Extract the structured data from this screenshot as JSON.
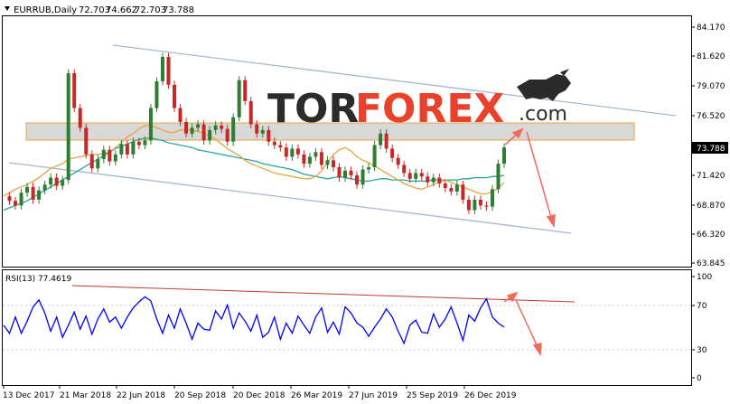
{
  "header": {
    "collapse_icon": "triangle-down-icon",
    "symbol": "EURRUB,Daily",
    "open": "72.703",
    "high": "74.662",
    "low": "72.703",
    "close": "73.788"
  },
  "logo": {
    "part1": "TOR",
    "part2": "FOREX",
    "part3": ".com",
    "icon": "bull-icon"
  },
  "price_axis": {
    "ticks": [
      "84.170",
      "81.620",
      "79.070",
      "76.520",
      "73.788",
      "71.420",
      "68.870",
      "66.320",
      "63.845"
    ],
    "current_price": "73.788",
    "range": [
      63.845,
      84.17
    ]
  },
  "rsi": {
    "label": "RSI(13) 77.4619",
    "levels": [
      "100",
      "70",
      "30",
      "0"
    ]
  },
  "date_axis": [
    "13 Dec 2017",
    "21 Mar 2018",
    "22 Jun 2018",
    "20 Sep 2018",
    "20 Dec 2018",
    "26 Mar 2019",
    "27 Jun 2019",
    "25 Sep 2019",
    "26 Dec 2019"
  ],
  "colors": {
    "bull_candle": "#2e7d32",
    "bear_candle": "#c62828",
    "ma_fast": "#e8a33b",
    "ma_slow": "#26a69a",
    "channel": "#a7b7cf",
    "resistance_zone": "#d8d8d8",
    "forecast_arrow": "#f26b5b",
    "rsi_line": "#0000ff",
    "rsi_trendline": "#c0392b",
    "logo_dark": "#2b2b2b",
    "logo_red": "#e8412c"
  },
  "chart_data": {
    "type": "line",
    "series": [
      {
        "values": [
          69.6,
          69.2,
          68.8,
          69.9,
          70.4,
          69.3,
          70.1,
          70.6,
          71.2,
          70.5,
          71.0,
          80.2,
          77.2,
          75.5,
          73.2,
          72.0,
          72.8,
          73.6,
          72.6,
          73.2,
          74.1,
          73.2,
          74.3,
          74.0,
          74.4,
          77.2,
          79.5,
          81.6,
          79.2,
          77.2,
          76.0,
          75.0,
          75.5,
          75.8,
          74.4,
          75.3,
          75.7,
          75.4,
          74.3,
          76.4,
          79.6,
          77.8,
          75.8,
          75.0,
          75.3,
          74.3,
          74.0,
          73.8,
          73.0,
          73.7,
          73.2,
          72.4,
          73.0,
          73.4,
          72.3,
          72.7,
          72.1,
          71.2,
          71.8,
          71.4,
          70.6,
          71.9,
          72.1,
          74.0,
          75.0,
          73.7,
          72.9,
          72.3,
          71.6,
          71.1,
          71.6,
          71.3,
          70.8,
          71.2,
          70.7,
          70.3,
          70.0,
          70.6,
          69.3,
          68.4,
          69.3,
          68.8,
          68.7,
          70.2,
          72.4,
          73.8
        ],
        "ma_fast": [
          69.6,
          69.9,
          70.2,
          70.4,
          70.6,
          70.9,
          71.2,
          71.6,
          72.0,
          72.2,
          72.4,
          72.8,
          72.9,
          73.0,
          73.1,
          73.2,
          73.2,
          73.3,
          73.4,
          73.8,
          74.2,
          74.7,
          75.0,
          75.4,
          75.7,
          75.7,
          75.5,
          75.3,
          75.1,
          75.1,
          75.3,
          75.3,
          75.3,
          75.2,
          75.0,
          74.8,
          74.5,
          74.1,
          73.7,
          73.4,
          73.1,
          72.7,
          72.4,
          72.2,
          72.0,
          71.8,
          71.6,
          71.5,
          71.4,
          71.3,
          71.2,
          71.1,
          71.1,
          71.3,
          71.8,
          72.5,
          73.2,
          73.6,
          73.8,
          73.5,
          73.0,
          72.7,
          72.5,
          72.2,
          71.9,
          71.6,
          71.3,
          71.0,
          70.7,
          70.5,
          70.3,
          70.2,
          70.4,
          70.6,
          70.8,
          71.0,
          70.8,
          70.6,
          70.4,
          70.2,
          70.0,
          69.8,
          69.8,
          70.0,
          70.3,
          70.8
        ],
        "ma_slow": [
          68.4,
          68.6,
          68.8,
          69.0,
          69.2,
          69.5,
          69.8,
          70.1,
          70.4,
          70.7,
          71.0,
          71.3,
          71.6,
          71.9,
          72.2,
          72.5,
          72.8,
          73.1,
          73.4,
          73.7,
          73.9,
          74.1,
          74.3,
          74.5,
          74.6,
          74.6,
          74.5,
          74.4,
          74.2,
          74.1,
          74.0,
          73.9,
          73.8,
          73.6,
          73.5,
          73.4,
          73.3,
          73.2,
          73.1,
          73.0,
          72.9,
          72.8,
          72.7,
          72.6,
          72.4,
          72.3,
          72.2,
          72.1,
          72.0,
          71.9,
          71.7,
          71.5,
          71.4,
          71.3,
          71.2,
          71.1,
          71.2,
          71.3,
          71.2,
          71.1,
          71.0,
          70.9,
          70.9,
          71.0,
          71.1,
          71.1,
          71.0,
          71.0,
          71.0,
          70.9,
          70.9,
          70.9,
          70.9,
          71.0,
          71.0,
          71.0,
          71.0,
          71.0,
          71.1,
          71.1,
          71.2,
          71.2,
          71.2,
          71.3,
          71.3,
          71.4
        ]
      }
    ],
    "rsi_values": [
      52,
      44,
      60,
      44,
      56,
      70,
      77,
      64,
      46,
      60,
      40,
      52,
      65,
      48,
      61,
      43,
      58,
      68,
      55,
      60,
      49,
      60,
      69,
      75,
      80,
      76,
      58,
      44,
      62,
      49,
      68,
      54,
      38,
      54,
      48,
      47,
      66,
      58,
      72,
      49,
      64,
      56,
      46,
      62,
      40,
      45,
      60,
      38,
      54,
      44,
      61,
      52,
      44,
      60,
      69,
      45,
      55,
      43,
      70,
      64,
      54,
      50,
      41,
      50,
      58,
      68,
      60,
      46,
      34,
      52,
      57,
      45,
      44,
      63,
      50,
      58,
      70,
      54,
      37,
      62,
      56,
      69,
      78,
      60,
      54,
      50
    ],
    "ylim": [
      63.845,
      84.17
    ],
    "rsi_ylim": [
      0,
      100
    ]
  }
}
